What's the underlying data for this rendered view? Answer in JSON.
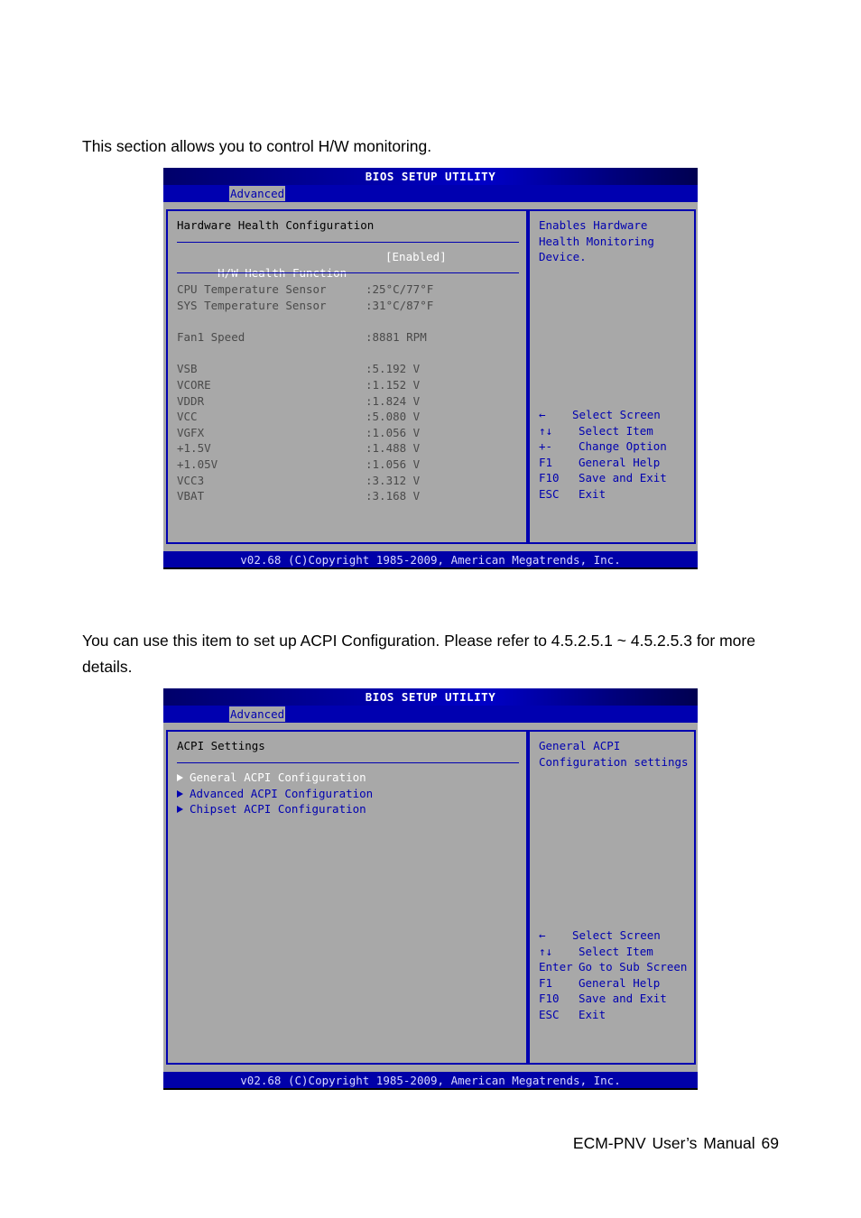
{
  "paragraphs": {
    "hw_intro": "This section allows you to control H/W monitoring.",
    "acpi_intro": "You can use this item to set up ACPI Configuration. Please refer to 4.5.2.5.1 ~ 4.5.2.5.3 for more details."
  },
  "footer": "ECM-PNV User’s Manual 69",
  "bios_common": {
    "title": "BIOS SETUP UTILITY",
    "active_tab": "Advanced",
    "copyright": "v02.68 (C)Copyright 1985-2009, American Megatrends, Inc.",
    "colors": {
      "blue": "#0000b0",
      "panel_gray": "#a8a8a8",
      "selected_text": "#ffffff"
    }
  },
  "screen1": {
    "heading": "Hardware Health Configuration",
    "setting": {
      "label": "H/W Health Function",
      "value": "[Enabled]"
    },
    "sensors": [
      {
        "label": "CPU Temperature Sensor",
        "value": ":25°C/77°F"
      },
      {
        "label": "SYS Temperature Sensor",
        "value": ":31°C/87°F"
      },
      {
        "label": "Fan1 Speed",
        "value": ":8881 RPM"
      },
      {
        "label": "VSB",
        "value": ":5.192 V"
      },
      {
        "label": "VCORE",
        "value": ":1.152 V"
      },
      {
        "label": "VDDR",
        "value": ":1.824 V"
      },
      {
        "label": "VCC",
        "value": ":5.080 V"
      },
      {
        "label": "VGFX",
        "value": ":1.056 V"
      },
      {
        "label": "+1.5V",
        "value": ":1.488 V"
      },
      {
        "label": "+1.05V",
        "value": ":1.056 V"
      },
      {
        "label": "VCC3",
        "value": ":3.312 V"
      },
      {
        "label": "VBAT",
        "value": ":3.168 V"
      }
    ],
    "help_lines": [
      "Enables Hardware",
      "Health Monitoring",
      "Device."
    ],
    "keys": [
      {
        "key": "←",
        "desc": "Select Screen"
      },
      {
        "key": "↑↓",
        "desc": "Select Item"
      },
      {
        "key": "+-",
        "desc": "Change Option"
      },
      {
        "key": "F1",
        "desc": "General Help"
      },
      {
        "key": "F10",
        "desc": "Save and Exit"
      },
      {
        "key": "ESC",
        "desc": "Exit"
      }
    ]
  },
  "screen2": {
    "heading": "ACPI Settings",
    "submenus": [
      {
        "label": "General ACPI Configuration"
      },
      {
        "label": "Advanced ACPI Configuration"
      },
      {
        "label": "Chipset ACPI Configuration"
      }
    ],
    "help_lines": [
      "General ACPI",
      "Configuration settings"
    ],
    "keys": [
      {
        "key": "←",
        "desc": "Select Screen"
      },
      {
        "key": "↑↓",
        "desc": "Select Item"
      },
      {
        "key": "Enter",
        "desc": "Go to Sub Screen"
      },
      {
        "key": "F1",
        "desc": "General Help"
      },
      {
        "key": "F10",
        "desc": "Save and Exit"
      },
      {
        "key": "ESC",
        "desc": "Exit"
      }
    ]
  }
}
